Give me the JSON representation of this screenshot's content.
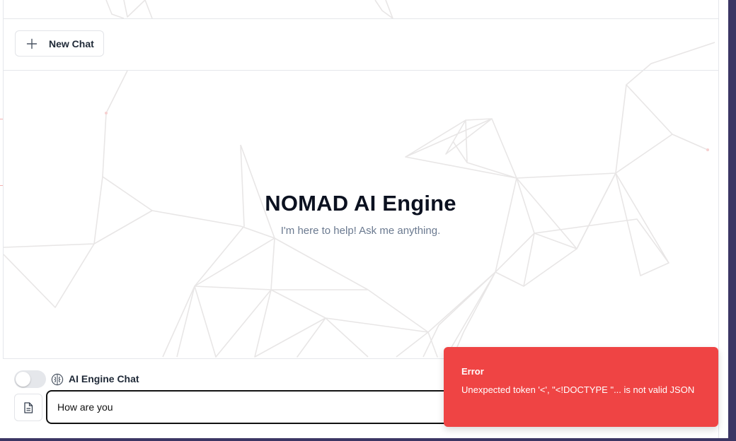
{
  "header": {
    "new_chat_label": "New Chat"
  },
  "hero": {
    "title": "NOMAD AI Engine",
    "subtitle": "I'm here to help! Ask me anything."
  },
  "composer": {
    "mode_toggle_on": false,
    "mode_label": "AI Engine Chat",
    "input_value": "How are you"
  },
  "toast": {
    "title": "Error",
    "message": "Unexpected token '<', \"<!DOCTYPE \"... is not valid JSON"
  },
  "colors": {
    "toast_bg": "#ef4444",
    "title_text": "#0b1120",
    "subtitle_text": "#6b7a90",
    "network_lines": "#e8e6e6"
  },
  "icons": {
    "new_chat": "plus-icon",
    "mode": "brain-icon",
    "attach": "file-icon"
  }
}
